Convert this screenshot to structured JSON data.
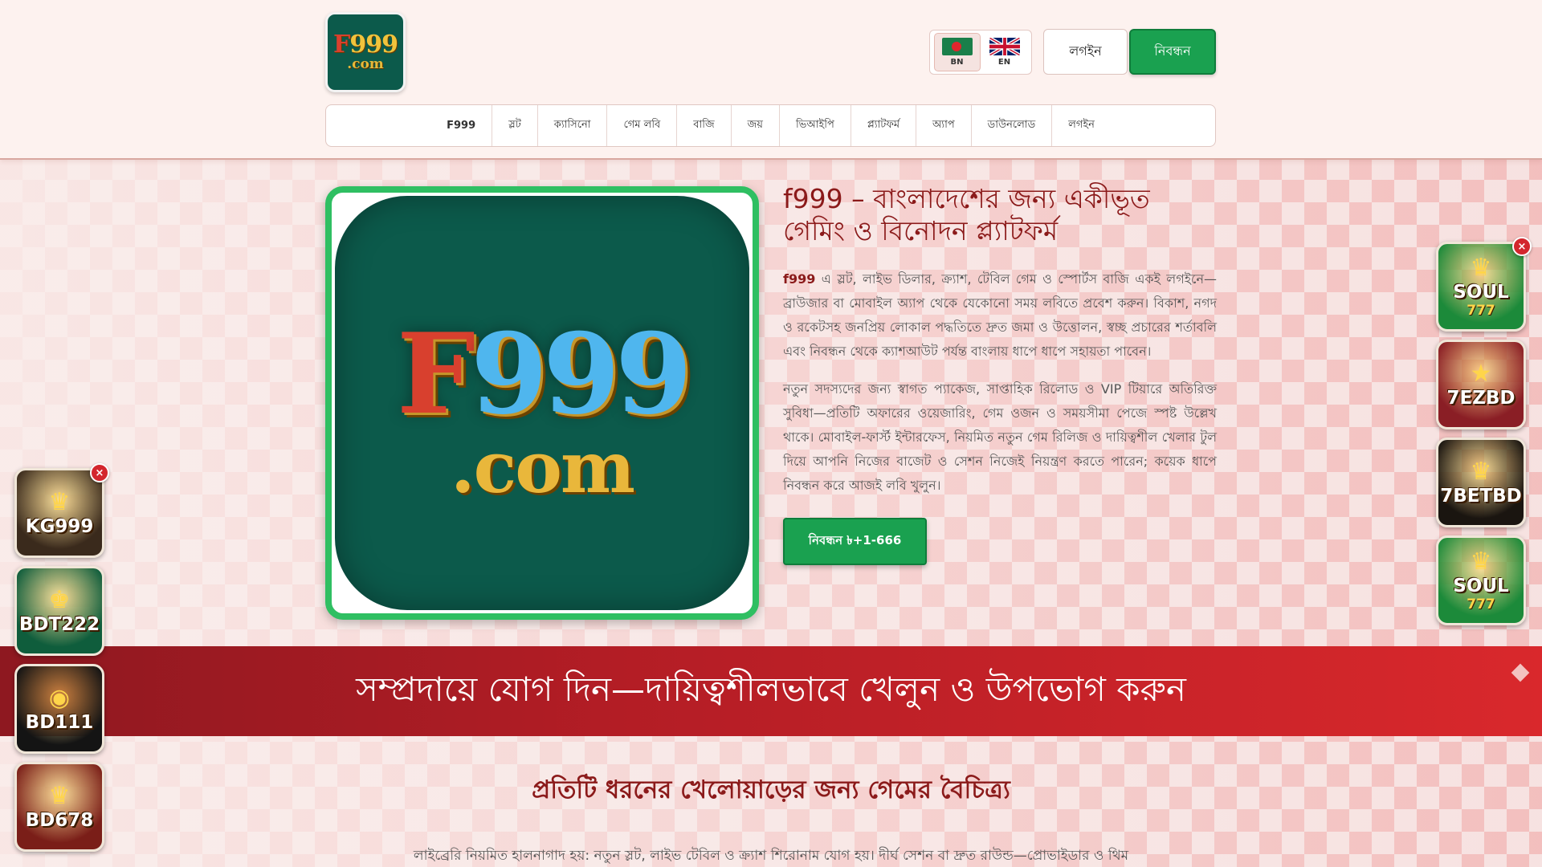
{
  "header": {
    "logo": {
      "line1_a": "F",
      "line1_b": "999",
      "line2": ".com"
    },
    "lang": {
      "bn": "BN",
      "en": "EN"
    },
    "login_label": "লগইন",
    "register_label": "নিবন্ধন"
  },
  "nav": {
    "items": [
      "F999",
      "স্লট",
      "ক্যাসিনো",
      "গেম লবি",
      "বাজি",
      "জয়",
      "ভিআইপি",
      "প্ল্যাটফর্ম",
      "অ্যাপ",
      "ডাউনলোড",
      "লগইন"
    ]
  },
  "hero": {
    "image": {
      "line1_a": "F",
      "line1_b": "999",
      "line2": ".com"
    },
    "title": "f999 – বাংলাদেশের জন্য একীভূত গেমিং ও বিনোদন প্ল্যাটফর্ম",
    "p1_brand": "f999",
    "p1_rest": " এ স্লট, লাইভ ডিলার, ক্র্যাশ, টেবিল গেম ও স্পোর্টস বাজি একই লগইনে—ব্রাউজার বা মোবাইল অ্যাপ থেকে যেকোনো সময় লবিতে প্রবেশ করুন। বিকাশ, নগদ ও রকেটসহ জনপ্রিয় লোকাল পদ্ধতিতে দ্রুত জমা ও উত্তোলন, স্বচ্ছ প্রচারের শর্তাবলি এবং নিবন্ধন থেকে ক্যাশআউট পর্যন্ত বাংলায় ধাপে ধাপে সহায়তা পাবেন।",
    "p2": "নতুন সদস্যদের জন্য স্বাগত প্যাকেজ, সাপ্তাহিক রিলোড ও VIP টিয়ারে অতিরিক্ত সুবিধা—প্রতিটি অফারের ওয়েজারিং, গেম ওজন ও সময়সীমা পেজে স্পষ্ট উল্লেখ থাকে। মোবাইল-ফার্স্ট ইন্টারফেস, নিয়মিত নতুন গেম রিলিজ ও দায়িত্বশীল খেলার টুল দিয়ে আপনি নিজের বাজেট ও সেশন নিজেই নিয়ন্ত্রণ করতে পারেন; কয়েক ধাপে নিবন্ধন করে আজই লবি খুলুন।",
    "cta_label": "নিবন্ধন ৳+1-666"
  },
  "banner": {
    "text": "সম্প্রদায়ে যোগ দিন—দায়িত্বশীলভাবে খেলুন ও উপভোগ করুন"
  },
  "section": {
    "title": "প্রতিটি ধরনের খেলোয়াড়ের জন্য গেমের বৈচিত্র্য",
    "text": "লাইব্রেরি নিয়মিত হালনাগাদ হয়: নতুন স্লট, লাইভ টেবিল ও ক্র্যাশ শিরোনাম যোগ হয়। দীর্ঘ সেশন বা দ্রুত রাউন্ড—প্রোভাইডার ও থিম"
  },
  "ads_left": [
    {
      "label": "KG999",
      "sub": "",
      "icon": "♛",
      "bg": "#3a2a1c"
    },
    {
      "label": "BDT222",
      "sub": "",
      "icon": "♚",
      "bg": "#0f5d3c"
    },
    {
      "label": "BD111",
      "sub": "",
      "icon": "◉",
      "bg": "#141414"
    },
    {
      "label": "BD678",
      "sub": "",
      "icon": "♛",
      "bg": "#7a1e18"
    }
  ],
  "ads_right": [
    {
      "label": "SOUL",
      "sub": "777",
      "icon": "♛",
      "bg": "#1c8a3a"
    },
    {
      "label": "7EZBD",
      "sub": "",
      "icon": "★",
      "bg": "#8a1e25"
    },
    {
      "label": "7BETBD",
      "sub": "",
      "icon": "♛",
      "bg": "#1a1510"
    },
    {
      "label": "SOUL",
      "sub": "777",
      "icon": "♛",
      "bg": "#1c8a3a"
    }
  ],
  "close_label": "×",
  "colors": {
    "brand_green": "#1aa150",
    "brand_red": "#8b1a1a",
    "banner_red": "#b31d25"
  }
}
